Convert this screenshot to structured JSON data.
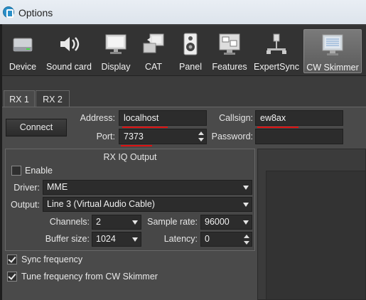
{
  "window": {
    "title": "Options"
  },
  "toolbar": {
    "items": [
      {
        "label": "Device",
        "icon": "hard-drive-icon"
      },
      {
        "label": "Sound card",
        "icon": "speaker-icon"
      },
      {
        "label": "Display",
        "icon": "monitor-icon"
      },
      {
        "label": "CAT",
        "icon": "computer-connection-icon"
      },
      {
        "label": "Panel",
        "icon": "panel-speaker-icon"
      },
      {
        "label": "Features",
        "icon": "features-windows-icon"
      },
      {
        "label": "ExpertSync",
        "icon": "network-sync-icon"
      },
      {
        "label": "CW Skimmer",
        "icon": "skimmer-display-icon"
      }
    ],
    "active": "CW Skimmer"
  },
  "tabs": {
    "rx1": "RX 1",
    "rx2": "RX 2",
    "active": "RX 1"
  },
  "connection": {
    "connect_label": "Connect",
    "address_label": "Address:",
    "address_value": "localhost",
    "port_label": "Port:",
    "port_value": "7373",
    "callsign_label": "Callsign:",
    "callsign_value": "ew8ax",
    "password_label": "Password:",
    "password_value": ""
  },
  "rx_iq": {
    "title": "RX IQ Output",
    "enable_label": "Enable",
    "enable_checked": false,
    "driver_label": "Driver:",
    "driver_value": "MME",
    "output_label": "Output:",
    "output_value": "Line 3 (Virtual Audio Cable)",
    "channels_label": "Channels:",
    "channels_value": "2",
    "sample_rate_label": "Sample rate:",
    "sample_rate_value": "96000",
    "buffer_size_label": "Buffer size:",
    "buffer_size_value": "1024",
    "latency_label": "Latency:",
    "latency_value": "0"
  },
  "options": {
    "sync_frequency_label": "Sync frequency",
    "sync_frequency_checked": true,
    "tune_frequency_label": "Tune frequency from CW Skimmer",
    "tune_frequency_checked": true
  },
  "colors": {
    "accent_underline": "#dd1111",
    "panel_bg": "#4a4a4a",
    "toolbar_bg": "#333333"
  }
}
